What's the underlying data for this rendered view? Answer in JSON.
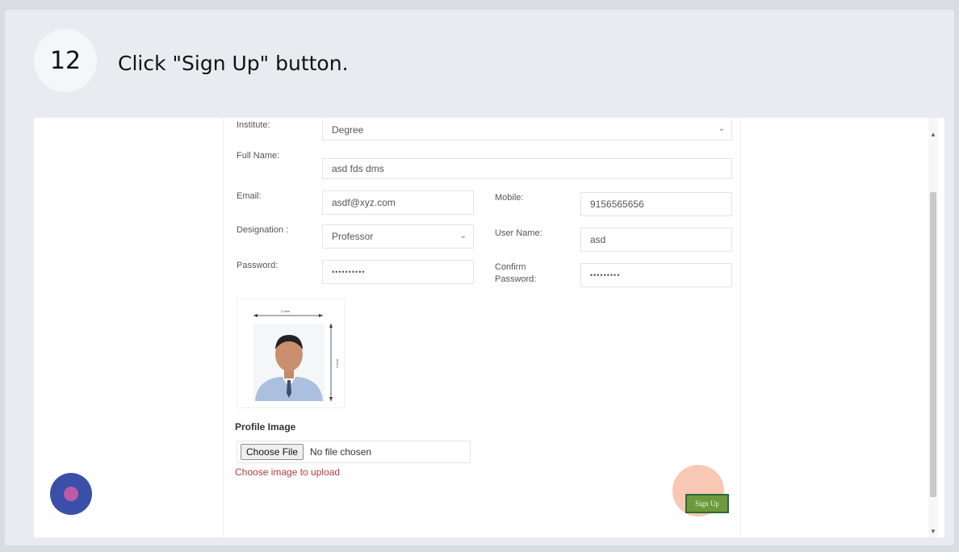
{
  "tutorial": {
    "step_number": "12",
    "step_title": "Click \"Sign Up\" button."
  },
  "form": {
    "institute": {
      "label": "Institute:",
      "value": "Degree"
    },
    "full_name": {
      "label": "Full Name:",
      "value": "asd fds dms"
    },
    "email": {
      "label": "Email:",
      "value": "asdf@xyz.com"
    },
    "mobile": {
      "label": "Mobile:",
      "value": "9156565656"
    },
    "designation": {
      "label": "Designation :",
      "value": "Professor"
    },
    "user_name": {
      "label": "User Name:",
      "value": "asd"
    },
    "password": {
      "label": "Password:",
      "value": "••••••••••"
    },
    "confirm_password": {
      "label_line1": "Confirm",
      "label_line2": "Password:",
      "value": "•••••••••"
    },
    "photo": {
      "width_label": "2 Inch",
      "height_label": "2 Inch"
    },
    "profile_image": {
      "title": "Profile Image",
      "choose_label": "Choose File",
      "no_file_text": "No file chosen",
      "hint": "Choose image to upload"
    },
    "signup_label": "Sign Up"
  },
  "colors": {
    "signup_bg": "#6e9a3e",
    "halo": "#f5aa8c",
    "hint_text": "#b04040",
    "cursor_outer": "#3a50a8",
    "cursor_inner": "#c05aa8"
  }
}
